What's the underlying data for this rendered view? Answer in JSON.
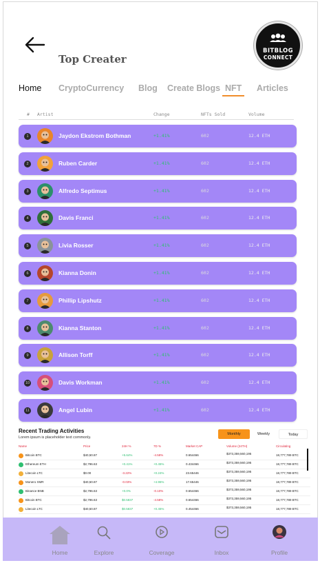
{
  "header": {
    "title": "Top Creater",
    "logo": {
      "line1": "BITBLOG",
      "line2": "CONNECT"
    }
  },
  "tabs": [
    {
      "label": "Home"
    },
    {
      "label": "CryptoCurrency"
    },
    {
      "label": "Blog"
    },
    {
      "label": "Create Blogs"
    },
    {
      "label": "NFT",
      "active": true
    },
    {
      "label": "Articles"
    }
  ],
  "table": {
    "headers": {
      "rank": "#",
      "artist": "Artist",
      "change": "Change",
      "nfts_sold": "NFTs Sold",
      "volume": "Volume"
    },
    "rows": [
      {
        "rank": "1",
        "name": "Jaydon Ekstrom Bothman",
        "change": "+1.41%",
        "nfts_sold": "602",
        "volume": "12.4 ETH",
        "avatar_color": "#e8852a"
      },
      {
        "rank": "2",
        "name": "Ruben Carder",
        "change": "+1.41%",
        "nfts_sold": "602",
        "volume": "12.4 ETH",
        "avatar_color": "#f2a23a"
      },
      {
        "rank": "3",
        "name": "Alfredo Septimus",
        "change": "+1.41%",
        "nfts_sold": "602",
        "volume": "12.4 ETH",
        "avatar_color": "#2c8f6a"
      },
      {
        "rank": "4",
        "name": "Davis Franci",
        "change": "+1.41%",
        "nfts_sold": "602",
        "volume": "12.4 ETH",
        "avatar_color": "#2f6f3a"
      },
      {
        "rank": "5",
        "name": "Livia Rosser",
        "change": "+1.41%",
        "nfts_sold": "602",
        "volume": "12.4 ETH",
        "avatar_color": "#8a9399"
      },
      {
        "rank": "6",
        "name": "Kianna Donin",
        "change": "+1.41%",
        "nfts_sold": "602",
        "volume": "12.4 ETH",
        "avatar_color": "#b5462c"
      },
      {
        "rank": "7",
        "name": "Phillip Lipshutz",
        "change": "+1.41%",
        "nfts_sold": "602",
        "volume": "12.4 ETH",
        "avatar_color": "#e69a3c"
      },
      {
        "rank": "8",
        "name": "Kianna Stanton",
        "change": "+1.41%",
        "nfts_sold": "602",
        "volume": "12.4 ETH",
        "avatar_color": "#4c8a6e"
      },
      {
        "rank": "9",
        "name": "Allison Torff",
        "change": "+1.41%",
        "nfts_sold": "602",
        "volume": "12.4 ETH",
        "avatar_color": "#c9a23a"
      },
      {
        "rank": "10",
        "name": "Davis Workman",
        "change": "+1.41%",
        "nfts_sold": "602",
        "volume": "12.4 ETH",
        "avatar_color": "#d64f7a"
      },
      {
        "rank": "11",
        "name": "Angel Lubin",
        "change": "+1.41%",
        "nfts_sold": "602",
        "volume": "12.4 ETH",
        "avatar_color": "#3a3a3a"
      }
    ]
  },
  "trading": {
    "title": "Recent Trading Activities",
    "subtitle": "Lorem ipsum is placeholder text commonly.",
    "filters": [
      "Monthly",
      "Weekly",
      "Today"
    ],
    "headers": [
      "Name",
      "Price",
      "24H %",
      "7D %",
      "Market CAP",
      "Volume (24TH)",
      "Circulating"
    ],
    "rows": [
      {
        "name": "Bitcoin BTC",
        "price": "$40,50.87",
        "h24": "+5.64%",
        "d7": "-4.58%",
        "cap": "0.654466",
        "vol": "$373,359,560,195",
        "circ": "18,777,789 BTC",
        "coin_color": "#f7931a"
      },
      {
        "name": "Ethereum ETH",
        "price": "$2,796.63",
        "h24": "+0.41%",
        "d7": "+0.45%",
        "cap": "0.434466",
        "vol": "$373,359,560,195",
        "circ": "18,777,789 BTC",
        "coin_color": "#2fbf71"
      },
      {
        "name": "Litecoin LTC",
        "price": "$0.00",
        "h24": "-3.22%",
        "d7": "+0.24%",
        "cap": "23.65446",
        "vol": "$373,359,560,195",
        "circ": "18,777,789 BTC",
        "coin_color": "#f2b03a"
      },
      {
        "name": "Monero XMR",
        "price": "$40,50.87",
        "h24": "-0.03%",
        "d7": "+4.95%",
        "cap": "17.65446",
        "vol": "$373,359,560,195",
        "circ": "18,777,789 BTC",
        "coin_color": "#f7931a"
      },
      {
        "name": "Binance BNB",
        "price": "$2,796.63",
        "h24": "+0.0%",
        "d7": "-0.10%",
        "cap": "0.654466",
        "vol": "$373,359,560,195",
        "circ": "18,777,789 BTC",
        "coin_color": "#2fbf71"
      },
      {
        "name": "Bitcoin BTC",
        "price": "$2,796.63",
        "h24": "$0.5837",
        "d7": "-4.58%",
        "cap": "0.654466",
        "vol": "$373,359,560,195",
        "circ": "18,777,789 BTC",
        "coin_color": "#f7931a"
      },
      {
        "name": "Litecoin LTC",
        "price": "$40,50.87",
        "h24": "$0.5837",
        "d7": "+0.45%",
        "cap": "0.454466",
        "vol": "$373,359,560,195",
        "circ": "18,777,789 BTC",
        "coin_color": "#f2b03a"
      }
    ]
  },
  "bottom_nav": [
    {
      "label": "Home",
      "icon": "home-icon"
    },
    {
      "label": "Explore",
      "icon": "search-icon"
    },
    {
      "label": "Coverage",
      "icon": "play-icon"
    },
    {
      "label": "Inbox",
      "icon": "inbox-icon"
    },
    {
      "label": "Profile",
      "icon": "avatar-icon"
    }
  ]
}
